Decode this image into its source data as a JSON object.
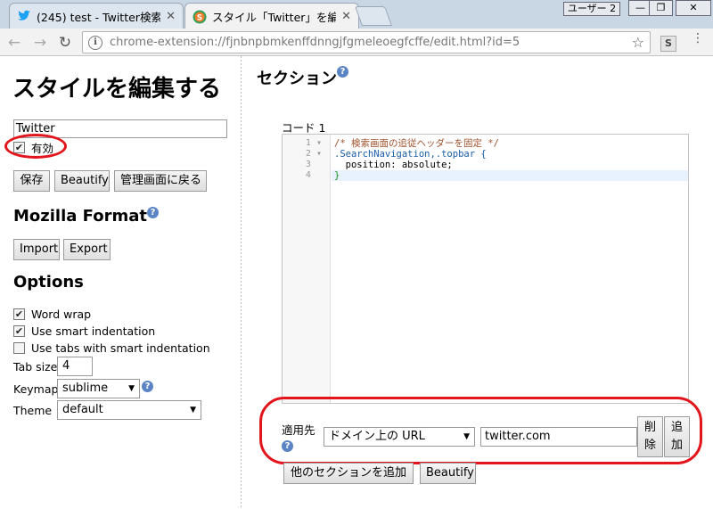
{
  "browser": {
    "tabs": [
      {
        "title": "(245) test - Twitter検索",
        "icon": "twitter-bird-icon"
      },
      {
        "title": "スタイル「Twitter」を編集",
        "icon": "stylish-s-icon"
      }
    ],
    "user_button": "ユーザー 2",
    "url": "chrome-extension://fjnbnpbmkenffdnngjfgmeleoegfcffe/edit.html?id=5",
    "extension_label": "S"
  },
  "left": {
    "title": "スタイルを編集する",
    "name_value": "Twitter",
    "enabled_label": "有効",
    "enabled_checked": true,
    "buttons": {
      "save": "保存",
      "beautify": "Beautify",
      "manage": "管理画面に戻る"
    },
    "mozilla_heading": "Mozilla Format",
    "import_label": "Import",
    "export_label": "Export",
    "options_heading": "Options",
    "options": {
      "word_wrap": "Word wrap",
      "smart_indent": "Use smart indentation",
      "tabs_smart": "Use tabs with smart indentation",
      "tab_size_label": "Tab size",
      "tab_size_value": "4",
      "keymap_label": "Keymap",
      "keymap_value": "sublime",
      "theme_label": "Theme",
      "theme_value": "default"
    }
  },
  "right": {
    "section_heading": "セクション",
    "code_label": "コード 1",
    "code_lines": [
      {
        "num": "1",
        "text": "/* 検索画面の追従ヘッダーを固定 */"
      },
      {
        "num": "2",
        "text": ".SearchNavigation,.topbar {"
      },
      {
        "num": "3",
        "text": "  position: absolute;"
      },
      {
        "num": "4",
        "text": "}"
      }
    ],
    "applies_label": "適用先",
    "applies_type": "ドメイン上の URL",
    "applies_value": "twitter.com",
    "delete_label": "削除",
    "add_label": "追加",
    "add_section_label": "他のセクションを追加",
    "beautify_label": "Beautify"
  },
  "colors": {
    "highlight_ring": "#e2141c",
    "help_icon": "#5b84c4"
  }
}
